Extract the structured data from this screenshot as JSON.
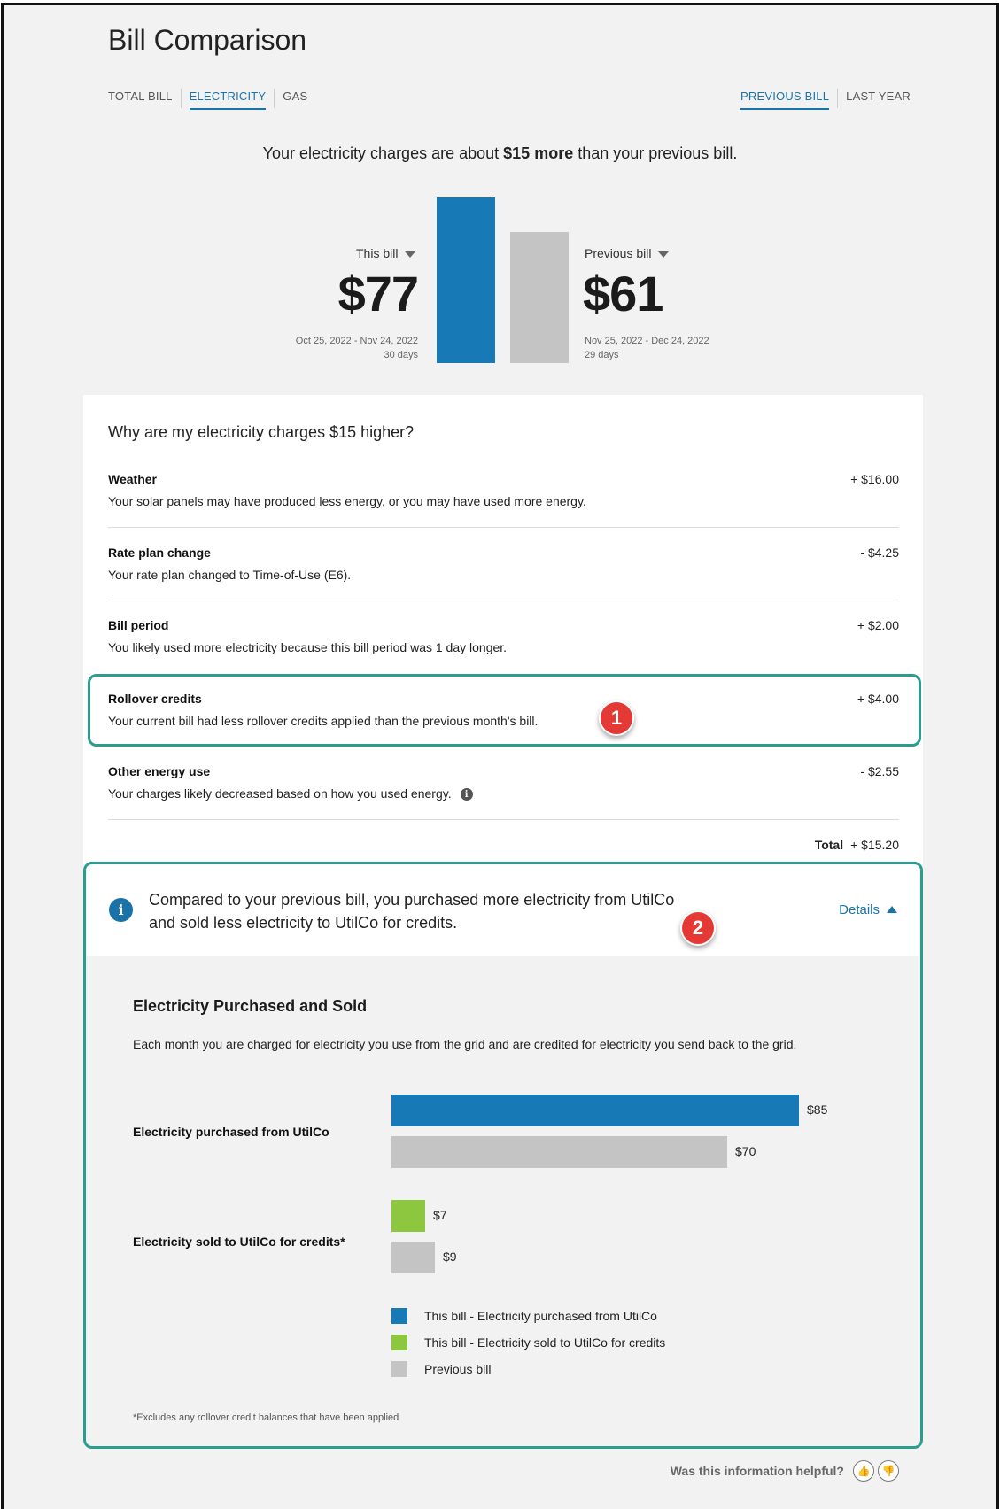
{
  "page": {
    "title": "Bill Comparison"
  },
  "tabs_left": [
    {
      "label": "TOTAL BILL",
      "active": false
    },
    {
      "label": "ELECTRICITY",
      "active": true
    },
    {
      "label": "GAS",
      "active": false
    }
  ],
  "tabs_right": [
    {
      "label": "PREVIOUS BILL",
      "active": true
    },
    {
      "label": "LAST YEAR",
      "active": false
    }
  ],
  "headline": {
    "prefix": "Your electricity charges are about ",
    "emphasis": "$15 more",
    "suffix": " than your previous bill."
  },
  "comparison": {
    "this_bill": {
      "label": "This bill",
      "amount": "$77",
      "dates": "Oct 25, 2022 - Nov 24, 2022",
      "days": "30 days",
      "value": 77
    },
    "previous_bill": {
      "label": "Previous bill",
      "amount": "$61",
      "dates": "Nov 25, 2022 - Dec 24, 2022",
      "days": "29 days",
      "value": 61
    },
    "colors": {
      "this": "#1779b5",
      "previous": "#c4c4c4"
    }
  },
  "why": {
    "question": "Why are my electricity charges $15 higher?",
    "rows": [
      {
        "title": "Weather",
        "desc": "Your solar panels may have produced less energy, or you may have used more energy.",
        "value": "+ $16.00"
      },
      {
        "title": "Rate plan change",
        "desc": "Your rate plan changed to Time-of-Use (E6).",
        "value": "- $4.25"
      },
      {
        "title": "Bill period",
        "desc": "You likely used more electricity because this bill period was 1 day longer.",
        "value": "+ $2.00"
      },
      {
        "title": "Rollover credits",
        "desc": "Your current bill had less rollover credits applied than the previous month's bill.",
        "value": "+ $4.00"
      },
      {
        "title": "Other energy use",
        "desc": "Your charges likely decreased based on how you used energy.",
        "value": "- $2.55"
      }
    ],
    "total_label": "Total",
    "total_value": "+ $15.20"
  },
  "badges": {
    "one": "1",
    "two": "2"
  },
  "banner": {
    "text": "Compared to your previous bill, you purchased more electricity from UtilCo and sold less electricity to UtilCo for credits.",
    "details_label": "Details"
  },
  "purchased_sold": {
    "title": "Electricity Purchased and Sold",
    "description": "Each month you are charged for electricity you use from the grid and are credited for electricity you send back to the grid.",
    "footnote": "*Excludes any rollover credit balances that have been applied"
  },
  "chart_data": {
    "type": "bar",
    "orientation": "horizontal",
    "categories": [
      "Electricity purchased from UtilCo",
      "Electricity sold to UtilCo for credits*"
    ],
    "series": [
      {
        "name": "This bill",
        "values": [
          85,
          7
        ],
        "labels": [
          "$85",
          "$7"
        ],
        "colors": [
          "#1779b5",
          "#8dc63f"
        ]
      },
      {
        "name": "Previous bill",
        "values": [
          70,
          9
        ],
        "labels": [
          "$70",
          "$9"
        ],
        "colors": [
          "#c4c4c4",
          "#c4c4c4"
        ]
      }
    ],
    "xlim": [
      0,
      85
    ],
    "legend": [
      {
        "label": "This bill - Electricity purchased from UtilCo",
        "color": "#1779b5"
      },
      {
        "label": "This bill - Electricity sold to UtilCo for credits",
        "color": "#8dc63f"
      },
      {
        "label": "Previous bill",
        "color": "#c4c4c4"
      }
    ],
    "legend_position": "bottom-left"
  },
  "feedback": {
    "question": "Was this information helpful?",
    "up_icon": "thumbs-up-icon",
    "down_icon": "thumbs-down-icon"
  }
}
